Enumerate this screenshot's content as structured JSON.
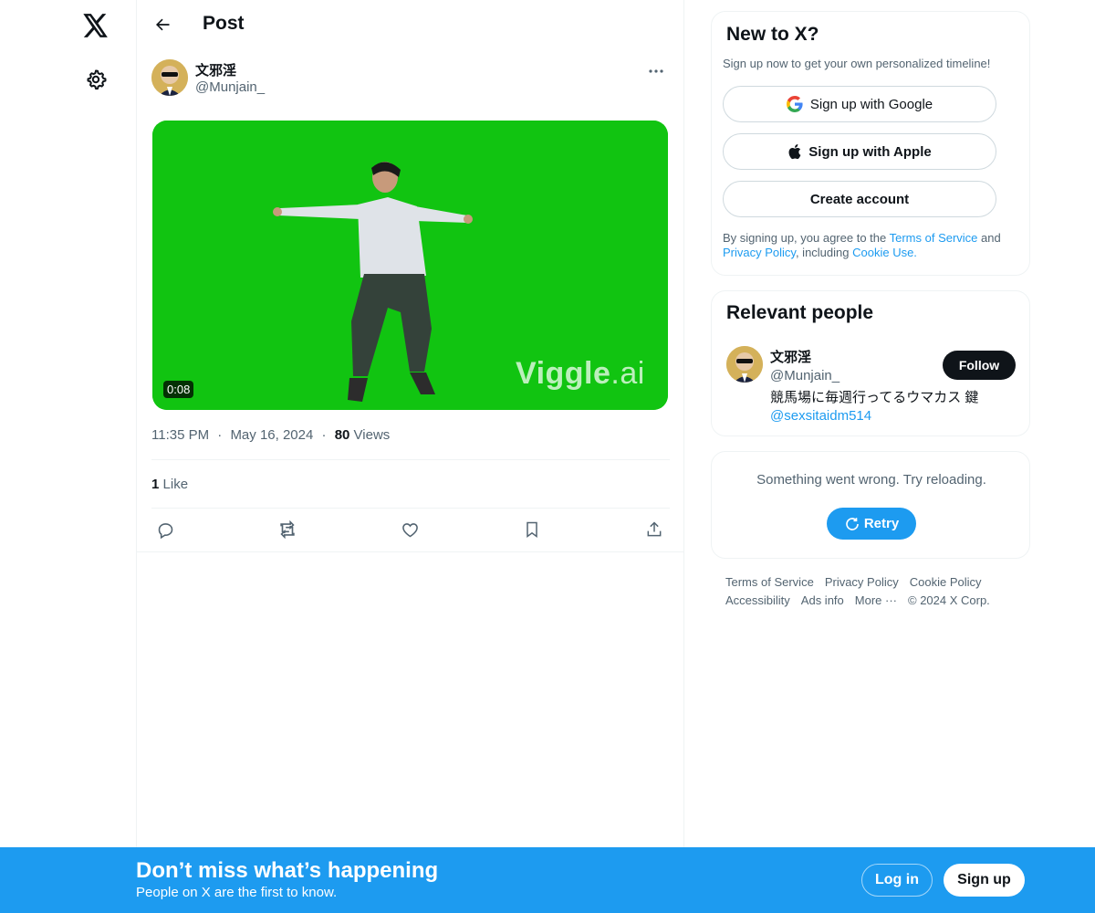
{
  "nav": {
    "logo_icon": "x-logo-icon",
    "settings_icon": "gear-icon"
  },
  "header": {
    "title": "Post",
    "back_icon": "arrow-left-icon"
  },
  "post": {
    "author_name": "文邪淫",
    "author_handle": "@Munjain_",
    "more_icon": "more-dots-icon",
    "media": {
      "duration": "0:08",
      "watermark_main": "iggle",
      "watermark_ai": ".ai",
      "background_color": "#11c411"
    },
    "time": "11:35 PM",
    "date": "May 16, 2024",
    "separator": "·",
    "views_count": "80",
    "views_label": "Views",
    "likes_count": "1",
    "likes_label": "Like",
    "actions": [
      "reply-icon",
      "repost-icon",
      "like-icon",
      "bookmark-icon",
      "share-icon"
    ]
  },
  "signup_card": {
    "title": "New to X?",
    "subtitle": "Sign up now to get your own personalized timeline!",
    "google_label": "Sign up with Google",
    "apple_label": "Sign up with Apple",
    "create_label": "Create account",
    "legal_prefix": "By signing up, you agree to the ",
    "terms_link": "Terms of Service",
    "legal_and": " and ",
    "privacy_link": "Privacy Policy",
    "legal_including": ", including ",
    "cookie_link": "Cookie Use.",
    "link_color": "#1d9bf0"
  },
  "relevant_people": {
    "title": "Relevant people",
    "name": "文邪淫",
    "handle": "@Munjain_",
    "bio_text": "競馬場に毎週行ってるウマカス 鍵",
    "bio_mention": "@sexsitaidm514",
    "follow_label": "Follow"
  },
  "error_card": {
    "message": "Something went wrong. Try reloading.",
    "retry_label": "Retry",
    "retry_icon": "refresh-icon",
    "accent": "#1d9bf0"
  },
  "footer": {
    "links": [
      "Terms of Service",
      "Privacy Policy",
      "Cookie Policy",
      "Accessibility",
      "Ads info",
      "More ···",
      "© 2024 X Corp."
    ]
  },
  "bottom_bar": {
    "title": "Don’t miss what’s happening",
    "subtitle": "People on X are the first to know.",
    "login_label": "Log in",
    "signup_label": "Sign up",
    "background": "#1d9bf0"
  }
}
